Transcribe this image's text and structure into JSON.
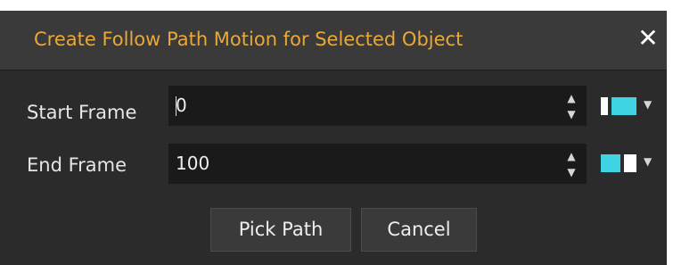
{
  "dialog": {
    "title": "Create Follow Path Motion for Selected Object",
    "close_glyph": "✕",
    "colors": {
      "title_text": "#e8a83a",
      "titlebar_bg": "#3a3a3a",
      "body_bg": "#2b2b2b",
      "field_bg": "#1a1a1a",
      "key_accent": "#3fd3e4"
    }
  },
  "fields": [
    {
      "label": "Start Frame",
      "value": "0",
      "icon": "keyframe-toggle-icon"
    },
    {
      "label": "End Frame",
      "value": "100",
      "icon": "keyframe-toggle-icon"
    }
  ],
  "spinner": {
    "up_glyph": "▲",
    "down_glyph": "▼"
  },
  "key_dropdown_glyph": "▼",
  "buttons": {
    "pick_path": "Pick Path",
    "cancel": "Cancel"
  }
}
